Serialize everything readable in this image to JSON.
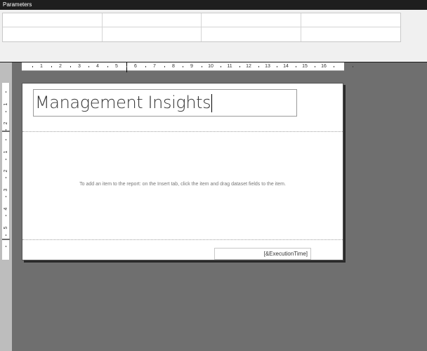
{
  "parameters_panel": {
    "title": "Parameters",
    "grid_rows": 2,
    "grid_cols": 4
  },
  "ruler": {
    "horizontal_labels": [
      "1",
      "2",
      "3",
      "4",
      "5",
      "6",
      "7",
      "8",
      "9",
      "10",
      "11",
      "12",
      "13",
      "14",
      "15",
      "16"
    ],
    "vertical_labels": [
      "1",
      "2",
      "1",
      "2",
      "3",
      "4",
      "5"
    ]
  },
  "report": {
    "title": "Management Insights",
    "hint": "To add an item to the report: on the Insert tab, click the item and drag dataset fields to the item.",
    "footer_expression": "[&ExecutionTime]"
  },
  "colors": {
    "header_bar": "#1e1e1e",
    "panel_bg": "#f0f0f0",
    "canvas_bg": "#6f6f6f",
    "page_bg": "#ffffff"
  }
}
